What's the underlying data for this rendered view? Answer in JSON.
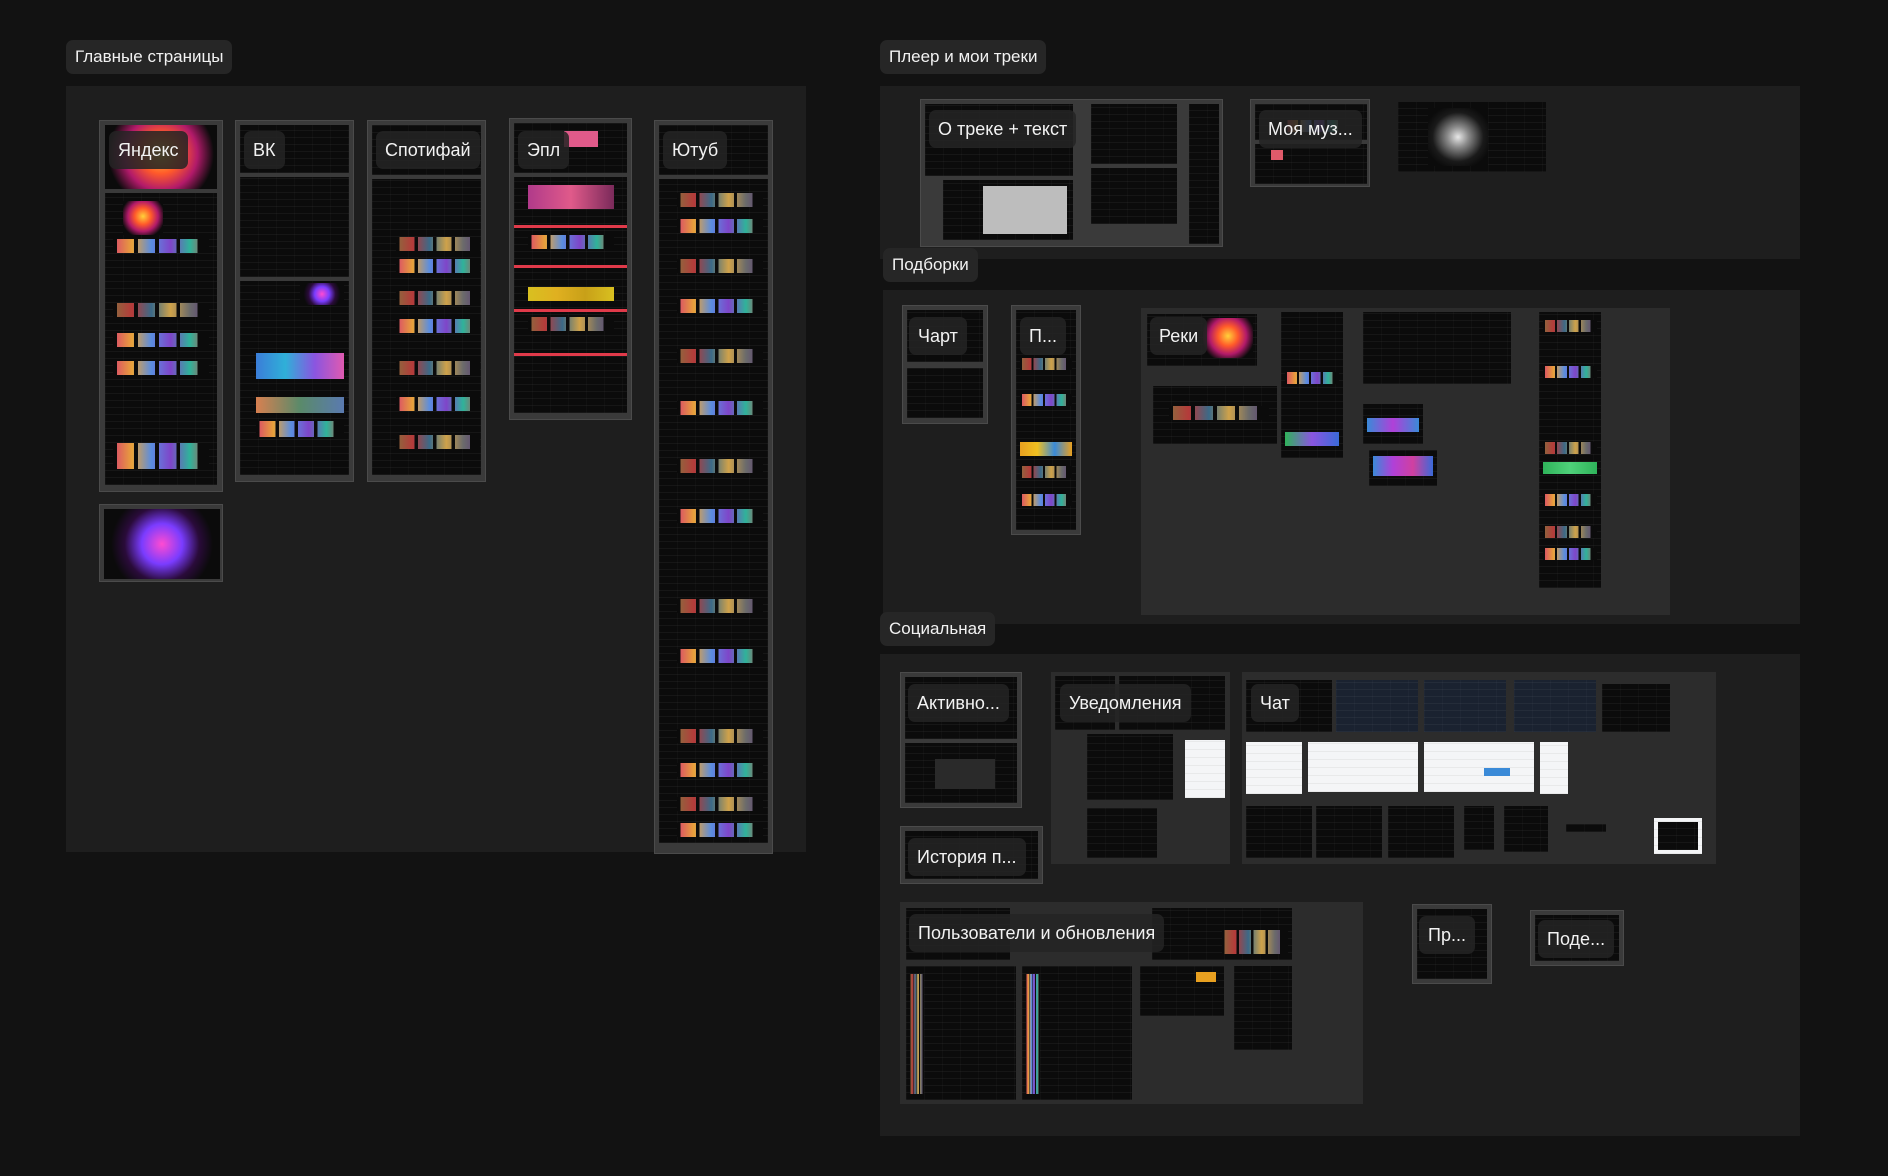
{
  "sections": {
    "main_pages": {
      "title": "Главные страницы",
      "frames": {
        "yandex": "Яндекс",
        "vk": "ВК",
        "spotify": "Спотифай",
        "apple": "Эпл",
        "youtube": "Ютуб"
      }
    },
    "player": {
      "title": "Плеер и мои треки",
      "frames": {
        "about_track": "О треке + текст",
        "my_music": "Моя муз..."
      }
    },
    "collections": {
      "title": "Подборки",
      "frames": {
        "chart": "Чарт",
        "p": "П...",
        "recs": "Реки"
      }
    },
    "social": {
      "title": "Социальная",
      "frames": {
        "activity": "Активно...",
        "notifications": "Уведомления",
        "chat": "Чат",
        "history": "История п...",
        "users": "Пользователи и обновления",
        "pr": "Пр...",
        "share": "Поде..."
      }
    }
  }
}
